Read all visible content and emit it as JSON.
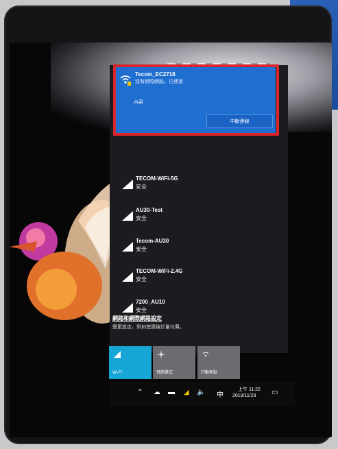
{
  "connected_network": {
    "name": "Tecom_EC2718",
    "status": "沒有網際網路，已連接",
    "properties_label": "內容",
    "disconnect_label": "中斷連線"
  },
  "networks": [
    {
      "name": "TECOM-WiFi-5G",
      "security": "安全"
    },
    {
      "name": "AU30-Test",
      "security": "安全"
    },
    {
      "name": "Tecom-AU30",
      "security": "安全"
    },
    {
      "name": "TECOM-WiFi-2.4G",
      "security": "安全"
    },
    {
      "name": "7200_AU10",
      "security": "安全"
    }
  ],
  "settings": {
    "link": "網路和網際網路設定",
    "description": "變更設定，例如使連線計量付費。"
  },
  "quick_actions": [
    {
      "label": "Wi-Fi",
      "icon": "wifi-icon",
      "active": true
    },
    {
      "label": "飛航模式",
      "icon": "airplane-icon",
      "active": false
    },
    {
      "label": "行動熱點",
      "icon": "hotspot-icon",
      "active": false
    }
  ],
  "taskbar": {
    "ime_indicator": "中",
    "time": "上午 11:22",
    "date": "2019/11/29"
  },
  "colors": {
    "accent": "#1f6fd1",
    "wifi_tile": "#18a6d6",
    "highlight_border": "#d8262c",
    "flyout_bg": "#1b1c1f"
  }
}
